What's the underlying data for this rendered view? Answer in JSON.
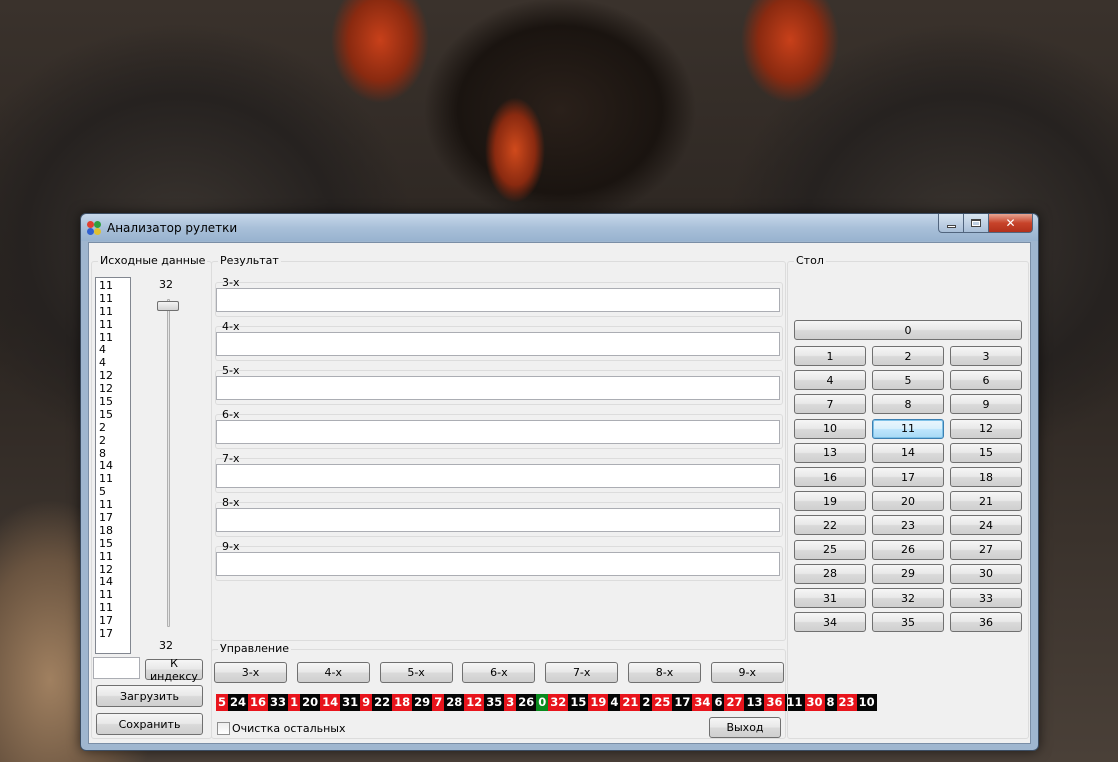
{
  "window": {
    "title": "Анализатор рулетки"
  },
  "source": {
    "group_label": "Исходные данные",
    "list": [
      "11",
      "11",
      "11",
      "11",
      "11",
      "4",
      "4",
      "12",
      "12",
      "15",
      "15",
      "2",
      "2",
      "8",
      "14",
      "11",
      "5",
      "11",
      "17",
      "18",
      "15",
      "11",
      "12",
      "14",
      "11",
      "11",
      "17",
      "17"
    ],
    "slider_top_value": "32",
    "slider_bottom_value": "32",
    "index_input_value": "",
    "to_index_label": "К индексу",
    "load_label": "Загрузить",
    "save_label": "Сохранить"
  },
  "result": {
    "group_label": "Результат",
    "rows": [
      {
        "label": "3-х",
        "value": ""
      },
      {
        "label": "4-х",
        "value": ""
      },
      {
        "label": "5-х",
        "value": ""
      },
      {
        "label": "6-х",
        "value": ""
      },
      {
        "label": "7-х",
        "value": ""
      },
      {
        "label": "8-х",
        "value": ""
      },
      {
        "label": "9-х",
        "value": ""
      }
    ]
  },
  "control": {
    "group_label": "Управление",
    "buttons": [
      "3-х",
      "4-х",
      "5-х",
      "6-х",
      "7-х",
      "8-х",
      "9-х"
    ],
    "strip": [
      {
        "n": "5",
        "c": "red"
      },
      {
        "n": "24",
        "c": "black"
      },
      {
        "n": "16",
        "c": "red"
      },
      {
        "n": "33",
        "c": "black"
      },
      {
        "n": "1",
        "c": "red"
      },
      {
        "n": "20",
        "c": "black"
      },
      {
        "n": "14",
        "c": "red"
      },
      {
        "n": "31",
        "c": "black"
      },
      {
        "n": "9",
        "c": "red"
      },
      {
        "n": "22",
        "c": "black"
      },
      {
        "n": "18",
        "c": "red"
      },
      {
        "n": "29",
        "c": "black"
      },
      {
        "n": "7",
        "c": "red"
      },
      {
        "n": "28",
        "c": "black"
      },
      {
        "n": "12",
        "c": "red"
      },
      {
        "n": "35",
        "c": "black"
      },
      {
        "n": "3",
        "c": "red"
      },
      {
        "n": "26",
        "c": "black"
      },
      {
        "n": "0",
        "c": "green"
      },
      {
        "n": "32",
        "c": "red"
      },
      {
        "n": "15",
        "c": "black"
      },
      {
        "n": "19",
        "c": "red"
      },
      {
        "n": "4",
        "c": "black"
      },
      {
        "n": "21",
        "c": "red"
      },
      {
        "n": "2",
        "c": "black"
      },
      {
        "n": "25",
        "c": "red"
      },
      {
        "n": "17",
        "c": "black"
      },
      {
        "n": "34",
        "c": "red"
      },
      {
        "n": "6",
        "c": "black"
      },
      {
        "n": "27",
        "c": "red"
      },
      {
        "n": "13",
        "c": "black"
      },
      {
        "n": "36",
        "c": "red"
      },
      {
        "n": "11",
        "c": "black"
      },
      {
        "n": "30",
        "c": "red"
      },
      {
        "n": "8",
        "c": "black"
      },
      {
        "n": "23",
        "c": "red"
      },
      {
        "n": "10",
        "c": "black"
      }
    ],
    "clear_others_label": "Очистка остальных",
    "exit_label": "Выход"
  },
  "table": {
    "group_label": "Стол",
    "zero": "0",
    "numbers": [
      "1",
      "2",
      "3",
      "4",
      "5",
      "6",
      "7",
      "8",
      "9",
      "10",
      "11",
      "12",
      "13",
      "14",
      "15",
      "16",
      "17",
      "18",
      "19",
      "20",
      "21",
      "22",
      "23",
      "24",
      "25",
      "26",
      "27",
      "28",
      "29",
      "30",
      "31",
      "32",
      "33",
      "34",
      "35",
      "36"
    ],
    "focused": "11"
  },
  "colors": {
    "red": "#e8141c",
    "black": "#050505",
    "green": "#0a8a1e"
  }
}
